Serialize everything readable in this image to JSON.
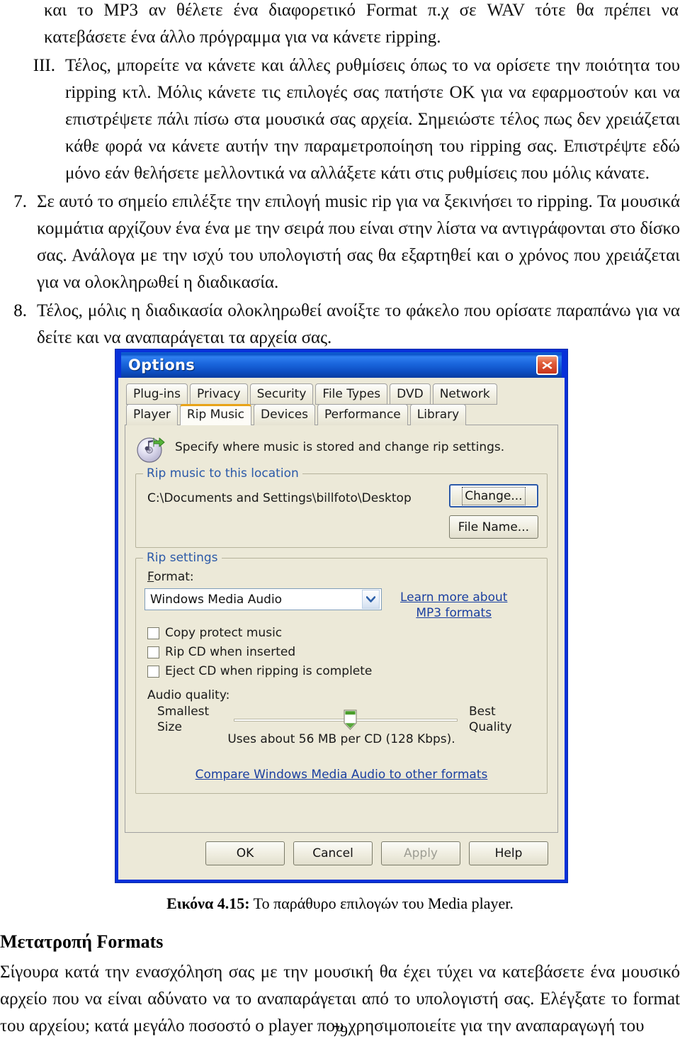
{
  "document": {
    "top_continuation": "και το MP3 αν θέλετε ένα διαφορετικό Format π.χ σε WAV τότε θα πρέπει να κατεβάσετε ένα άλλο πρόγραμμα για να κάνετε ripping.",
    "item_roman": {
      "marker": "III.",
      "text": "Τέλος, μπορείτε να κάνετε και άλλες ρυθμίσεις όπως το να ορίσετε την ποιότητα του ripping κτλ. Μόλις κάνετε τις επιλογές σας πατήστε ΟΚ για να εφαρμοστούν και να επιστρέψετε πάλι πίσω στα μουσικά σας αρχεία. Σημειώστε τέλος πως δεν χρειάζεται κάθε φορά να κάνετε αυτήν την παραμετροποίηση του ripping σας. Επιστρέψτε εδώ μόνο εάν θελήσετε μελλοντικά να αλλάξετε κάτι στις ρυθμίσεις που μόλις κάνατε."
    },
    "item_7": {
      "marker": "7.",
      "text": "Σε αυτό το σημείο επιλέξτε την επιλογή music rip για να ξεκινήσει το ripping. Τα μουσικά κομμάτια αρχίζουν ένα ένα με την σειρά που είναι στην λίστα να αντιγράφονται στο δίσκο σας. Ανάλογα με την ισχύ του υπολογιστή σας θα εξαρτηθεί και ο χρόνος που χρειάζεται για να ολοκληρωθεί η διαδικασία."
    },
    "item_8": {
      "marker": "8.",
      "text": "Τέλος, μόλις η διαδικασία ολοκληρωθεί ανοίξτε το φάκελο που ορίσατε παραπάνω για να δείτε και να αναπαράγεται τα αρχεία σας."
    },
    "figure_caption_label": "Εικόνα 4.15:",
    "figure_caption_text": " Το παράθυρο επιλογών του Media player.",
    "section_heading": "Μετατροπή Formats",
    "body_paragraph": "Σίγουρα κατά την ενασχόληση σας με την μουσική θα έχει τύχει να κατεβάσετε ένα μουσικό αρχείο που να είναι αδύνατο να το αναπαράγεται από το υπολογιστή σας. Ελέγξατε το format του αρχείου; κατά μεγάλο ποσοστό ο player που χρησιμοποιείτε για την αναπαραγωγή του",
    "page_number": "79"
  },
  "dialog": {
    "title": "Options",
    "close_icon": "close-icon",
    "tabs_row1": [
      {
        "label": "Plug-ins",
        "active": false
      },
      {
        "label": "Privacy",
        "active": false
      },
      {
        "label": "Security",
        "active": false
      },
      {
        "label": "File Types",
        "active": false
      },
      {
        "label": "DVD",
        "active": false
      },
      {
        "label": "Network",
        "active": false
      }
    ],
    "tabs_row2": [
      {
        "label": "Player",
        "active": false
      },
      {
        "label": "Rip Music",
        "active": true
      },
      {
        "label": "Devices",
        "active": false
      },
      {
        "label": "Performance",
        "active": false
      },
      {
        "label": "Library",
        "active": false
      }
    ],
    "pane": {
      "header_icon": "rip-cd-icon",
      "header_text": "Specify where music is stored and change rip settings.",
      "location_group": {
        "legend": "Rip music to this location",
        "path_value": "C:\\Documents and Settings\\billfoto\\Desktop",
        "change_button": "Change...",
        "file_name_button": "File Name..."
      },
      "rip_settings_group": {
        "legend": "Rip settings",
        "format_label": "Format:",
        "format_value": "Windows Media Audio",
        "format_arrow_icon": "chevron-down-icon",
        "learn_more_line1": "Learn more about",
        "learn_more_line2": "MP3 formats",
        "checkboxes": [
          {
            "label": "Copy protect music",
            "checked": false
          },
          {
            "label": "Rip CD when inserted",
            "checked": false
          },
          {
            "label": "Eject CD when ripping is complete",
            "checked": false
          }
        ],
        "audio_quality_label": "Audio quality:",
        "slider_left_line1": "Smallest",
        "slider_left_line2": "Size",
        "slider_right_line1": "Best",
        "slider_right_line2": "Quality",
        "slider_position_percent": 52,
        "uses_text": "Uses about 56 MB per CD (128 Kbps).",
        "compare_link": "Compare Windows Media Audio to other formats"
      }
    },
    "footer_buttons": [
      {
        "label": "OK",
        "disabled": false
      },
      {
        "label": "Cancel",
        "disabled": false
      },
      {
        "label": "Apply",
        "disabled": true
      },
      {
        "label": "Help",
        "disabled": false
      }
    ],
    "colors": {
      "titlebar_blue": "#0a52c8",
      "dialog_border": "#0831d9",
      "face": "#ece9d8",
      "active_tab_accent": "#e8a317",
      "link": "#1a3fa0",
      "legend": "#2b59a8",
      "close_red": "#c8331a",
      "slider_green": "#4a9e2a"
    }
  }
}
